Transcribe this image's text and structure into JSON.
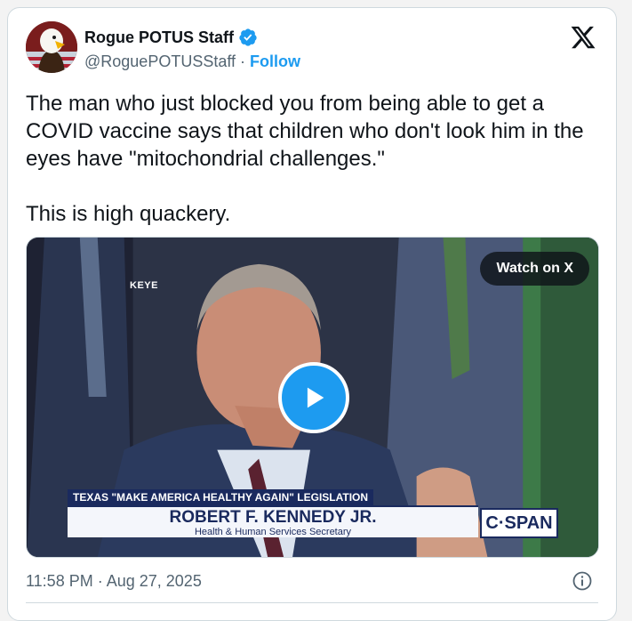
{
  "author": {
    "name": "Rogue POTUS Staff",
    "handle": "@RoguePOTUSStaff",
    "separator": " · ",
    "follow_label": "Follow",
    "verified_icon": "verified-badge-icon",
    "avatar_icon": "bald-eagle-avatar"
  },
  "tweet": {
    "text": "The man who just blocked you from being able to get a COVID vaccine says that children who don't look him in the eyes have \"mitochondrial challenges.\"\n\nThis is high quackery."
  },
  "media": {
    "watch_label": "Watch on X",
    "sign_text": "KEYE",
    "lower_third": {
      "headline": "TEXAS \"MAKE AMERICA HEALTHY AGAIN\" LEGISLATION",
      "name": "ROBERT F. KENNEDY JR.",
      "title": "Health & Human Services Secretary",
      "network": "C·SPAN"
    }
  },
  "footer": {
    "time": "11:58 PM",
    "date": "Aug 27, 2025",
    "separator": " · "
  },
  "colors": {
    "accent": "#1d9bf0",
    "text": "#0f1419",
    "muted": "#536471",
    "border": "#cfd9de"
  }
}
